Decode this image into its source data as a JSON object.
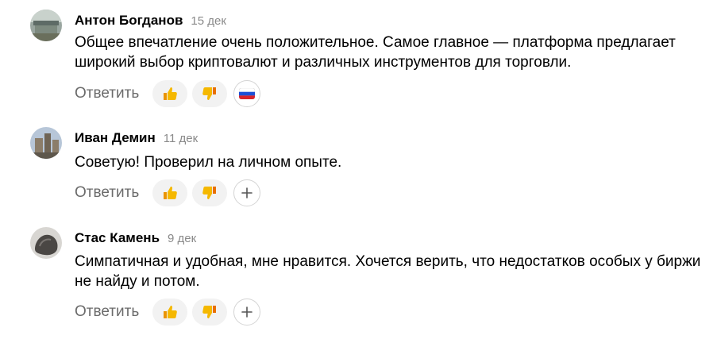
{
  "comments": [
    {
      "author": "Антон Богданов",
      "date": "15 дек",
      "text": "Общее впечатление очень положительное. Самое главное — платформа предлагает широкий выбор криптовалют и различных инструментов для торговли.",
      "reply_label": "Ответить",
      "reactions": [
        "thumbs-up-icon",
        "thumbs-down-icon",
        "russian-flag-icon"
      ]
    },
    {
      "author": "Иван Демин",
      "date": "11 дек",
      "text": "Советую! Проверил на личном опыте.",
      "reply_label": "Ответить",
      "reactions": [
        "thumbs-up-icon",
        "thumbs-down-icon",
        "plus-icon"
      ]
    },
    {
      "author": "Стас Камень",
      "date": "9 дек",
      "text": "Симпатичная и удобная, мне нравится. Хочется верить, что недостатков особых у биржи не найду и потом.",
      "reply_label": "Ответить",
      "reactions": [
        "thumbs-up-icon",
        "thumbs-down-icon",
        "plus-icon"
      ]
    }
  ],
  "colors": {
    "author": "#000000",
    "date": "#8a8a8a",
    "reply": "#6b6b6b",
    "reaction_bg": "#f2f2f2",
    "thumb": "#f5b800"
  }
}
